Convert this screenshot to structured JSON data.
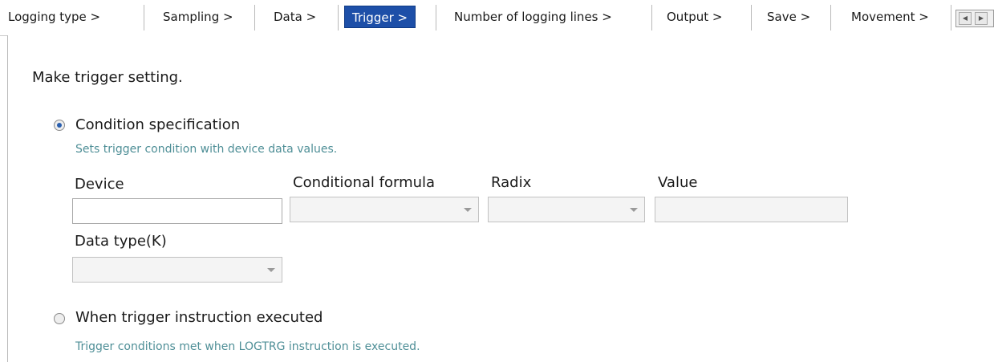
{
  "tabs": [
    {
      "label": "Logging type >",
      "active": false
    },
    {
      "label": "Sampling >",
      "active": false
    },
    {
      "label": "Data >",
      "active": false
    },
    {
      "label": "Trigger >",
      "active": true
    },
    {
      "label": "Number of logging lines >",
      "active": false
    },
    {
      "label": "Output >",
      "active": false
    },
    {
      "label": "Save >",
      "active": false
    },
    {
      "label": "Movement >",
      "active": false
    }
  ],
  "scroll_buttons": {
    "left_icon": "chevron-left-icon",
    "right_icon": "chevron-right-icon"
  },
  "instruction": "Make trigger setting.",
  "condition_option": {
    "label": "Condition specification",
    "description": "Sets trigger condition with device data values.",
    "selected": true
  },
  "fields": {
    "device": {
      "label": "Device",
      "value": ""
    },
    "conditional_formula": {
      "label": "Conditional formula",
      "value": ""
    },
    "radix": {
      "label": "Radix",
      "value": ""
    },
    "value": {
      "label": "Value",
      "value": ""
    },
    "data_type": {
      "label": "Data type(K)",
      "value": ""
    }
  },
  "instruction_option": {
    "label": "When trigger instruction executed",
    "description": "Trigger conditions met when LOGTRG instruction is executed.",
    "selected": false
  },
  "colors": {
    "active_tab": "#1d4fa8",
    "description_text": "#4f8f97"
  }
}
